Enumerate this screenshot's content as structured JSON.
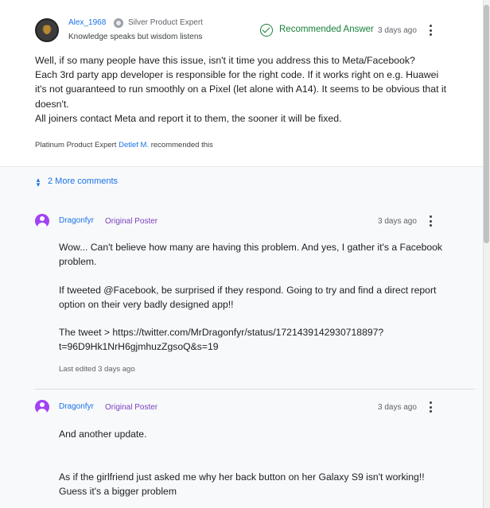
{
  "answer": {
    "author": "Alex_1968",
    "expert_level": "Silver Product Expert",
    "tagline": "Knowledge speaks but wisdom listens",
    "recommended_label": "Recommended Answer",
    "timestamp": "3 days ago",
    "body": [
      "Well, if so many people have this issue, isn't it time you address this to Meta/Facebook?",
      "Each 3rd party app developer is responsible for the right code. If it works right on e.g. Huawei it's not guaranteed to run smoothly on a Pixel (let alone with A14). It seems to be obvious that it doesn't.",
      "All joiners contact Meta and report it to them, the sooner it will be fixed."
    ],
    "recommendation": {
      "prefix": "Platinum Product Expert",
      "recommender": "Detlef M.",
      "suffix": "recommended this"
    }
  },
  "more_comments_label": "2 More comments",
  "comments": [
    {
      "author": "Dragonfyr",
      "badge": "Original Poster",
      "timestamp": "3 days ago",
      "paragraphs": [
        "Wow... Can't believe how many are having this problem. And yes, I gather it's a Facebook problem.",
        "If tweeted @Facebook, be surprised if they respond. Going to try and find a direct report option on their very badly designed app!!",
        "The tweet > https://twitter.com/MrDragonfyr/status/1721439142930718897?t=96D9Hk1NrH6gjmhuzZgsoQ&s=19"
      ],
      "edited": "Last edited 3 days ago"
    },
    {
      "author": "Dragonfyr",
      "badge": "Original Poster",
      "timestamp": "3 days ago",
      "paragraphs": [
        "And another update.",
        "As if the girlfriend just asked me why her back button on her Galaxy S9 isn't working!! Guess it's a bigger problem"
      ]
    }
  ],
  "icons": {
    "avatar": "profile-photo",
    "expert": "silver-expert-badge-icon",
    "recommended": "check-circle-icon",
    "menu": "more-vert-icon",
    "expand": "unfold-more-icon",
    "user": "account-circle-icon"
  },
  "colors": {
    "link": "#1a73e8",
    "recommended": "#188038",
    "original_poster": "#7b3fbf",
    "user_icon": "#a142f4",
    "comments_bg": "#f8f9fa"
  }
}
